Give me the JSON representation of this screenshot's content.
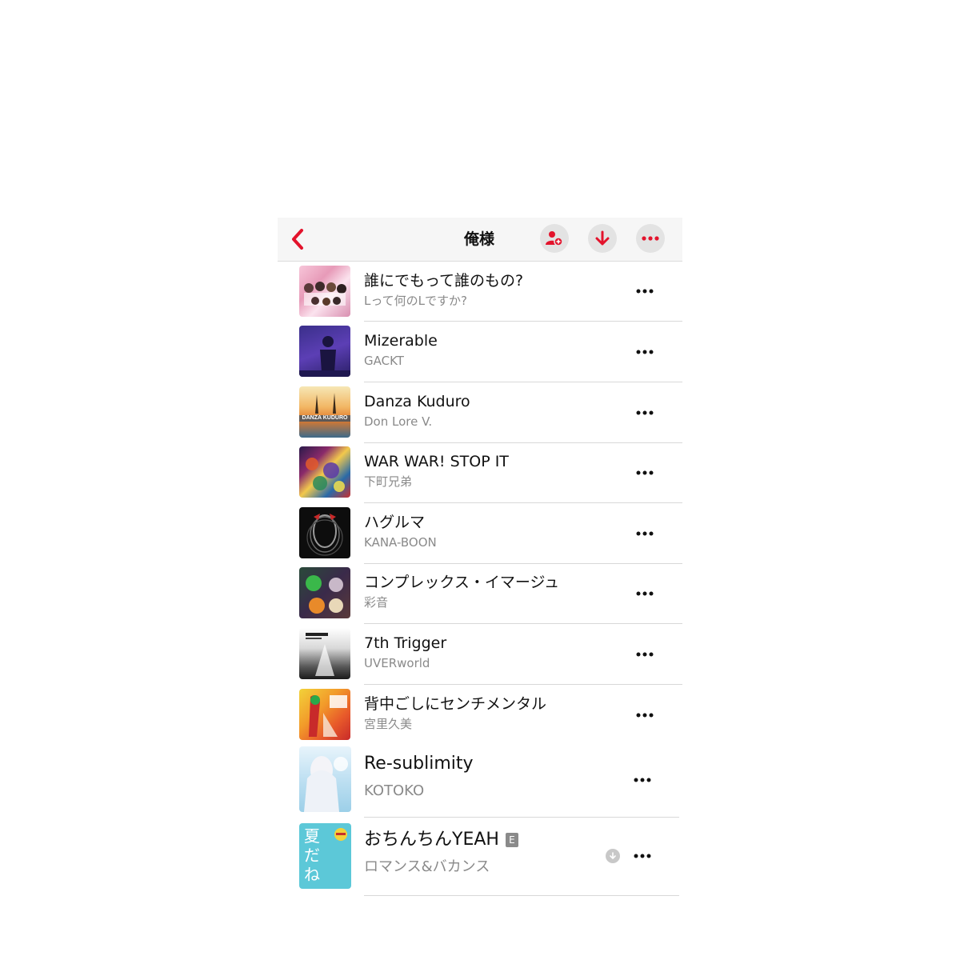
{
  "header": {
    "title": "俺様",
    "back_icon": "chevron-left-icon",
    "actions": [
      "add-person-icon",
      "download-icon",
      "more-icon"
    ]
  },
  "accent_color": "#e3132c",
  "songs": [
    {
      "title": "誰にでもって誰のもの?",
      "artist": "Lって何のLですか?"
    },
    {
      "title": "Mizerable",
      "artist": "GACKT"
    },
    {
      "title": "Danza Kuduro",
      "artist": "Don Lore V."
    },
    {
      "title": "WAR WAR! STOP IT",
      "artist": "下町兄弟"
    },
    {
      "title": "ハグルマ",
      "artist": "KANA-BOON"
    },
    {
      "title": "コンプレックス・イマージュ",
      "artist": "彩音"
    },
    {
      "title": "7th Trigger",
      "artist": "UVERworld"
    },
    {
      "title": "背中ごしにセンチメンタル",
      "artist": "宮里久美"
    },
    {
      "title": "Re-sublimity",
      "artist": "KOTOKO"
    },
    {
      "title": "おちんちんYEAH",
      "artist": "ロマンス&バカンス",
      "explicit_badge": "E",
      "downloaded": true
    }
  ],
  "artwork_text": {
    "row2": "DANZA KUDURO",
    "row9": "夏だね"
  }
}
